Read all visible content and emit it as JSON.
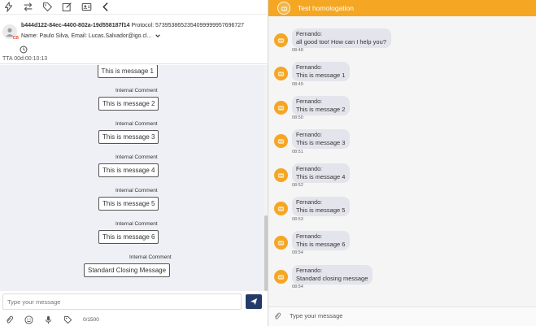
{
  "toolbar": {
    "icons": [
      "lightning-icon",
      "transfer-icon",
      "tag-icon",
      "edit-icon",
      "contact-card-icon",
      "back-chevron-icon"
    ]
  },
  "ticket": {
    "id": "b444d122-84ec-4400-802a-19d558187f14",
    "protocol_label": "Protocol:",
    "protocol": "5739538652354099999957696727",
    "name_line": "Name: Paulo Silva, Email: Lucas.Salvador@igo.cl...",
    "avatar_tag": "CB",
    "tta": "TTA 00d:00:10:13"
  },
  "left_messages": {
    "comment_label": "Internal Comment",
    "items": [
      "This is message 1",
      "This is message 2",
      "This is message 3",
      "This is message 4",
      "This is message 5",
      "This is message 6",
      "Standard Closing Message"
    ]
  },
  "composer": {
    "placeholder": "Type your message",
    "counter": "0/1500"
  },
  "right": {
    "title": "Test homologation",
    "placeholder": "Type your message",
    "header_color": "#f5a623",
    "messages": [
      {
        "sender": "Fernando:",
        "text": "all good too! How can I help you?",
        "time": "08:48"
      },
      {
        "sender": "Fernando:",
        "text": "This is message 1",
        "time": "08:49"
      },
      {
        "sender": "Fernando:",
        "text": "This is message 2",
        "time": "08:50"
      },
      {
        "sender": "Fernando:",
        "text": "This is message 3",
        "time": "08:51"
      },
      {
        "sender": "Fernando:",
        "text": "This is message 4",
        "time": "08:52"
      },
      {
        "sender": "Fernando:",
        "text": "This is message 5",
        "time": "08:53"
      },
      {
        "sender": "Fernando:",
        "text": "This is message 6",
        "time": "08:54"
      },
      {
        "sender": "Fernando:",
        "text": "Standard closing message",
        "time": "08:54"
      }
    ]
  }
}
